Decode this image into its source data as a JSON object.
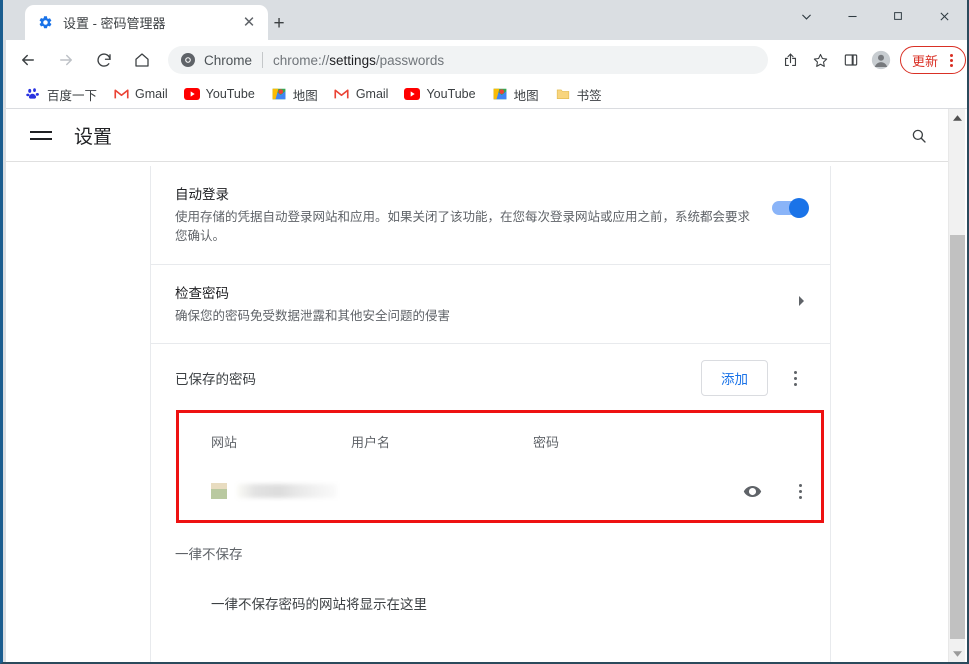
{
  "window": {
    "controls": [
      {
        "name": "tab-search-button",
        "glyph": "⌄"
      },
      {
        "name": "minimize-button",
        "glyph": "—"
      },
      {
        "name": "maximize-button",
        "glyph": "□"
      },
      {
        "name": "close-button",
        "glyph": "✕"
      }
    ]
  },
  "tab": {
    "title": "设置 - 密码管理器",
    "favicon": "gear-icon",
    "close_label": "✕",
    "newtab_label": "+"
  },
  "toolbar": {
    "back_label": "←",
    "forward_label": "→",
    "reload_label": "⟳",
    "home_label": "⌂",
    "omnibox": {
      "chrome_label": "Chrome",
      "url_prefix": "chrome://",
      "url_bold": "settings",
      "url_suffix": "/passwords",
      "full_url": "chrome://settings/passwords"
    },
    "share_label": "share-icon",
    "bookmark_label": "star-icon",
    "sidepanel_label": "side-panel-icon",
    "profile_label": "profile-avatar",
    "update_label": "更新"
  },
  "bookmarks": [
    {
      "label": "百度一下",
      "icon": "baidu-icon"
    },
    {
      "label": "Gmail",
      "icon": "gmail-icon"
    },
    {
      "label": "YouTube",
      "icon": "youtube-icon"
    },
    {
      "label": "地图",
      "icon": "maps-icon"
    },
    {
      "label": "Gmail",
      "icon": "gmail-icon"
    },
    {
      "label": "YouTube",
      "icon": "youtube-icon"
    },
    {
      "label": "地图",
      "icon": "maps-icon"
    },
    {
      "label": "书签",
      "icon": "folder-icon"
    }
  ],
  "settings": {
    "title": "设置",
    "menu_label": "hamburger-icon",
    "search_label": "search-icon"
  },
  "sections": {
    "autosignin": {
      "title": "自动登录",
      "subtitle": "使用存储的凭据自动登录网站和应用。如果关闭了该功能，在您每次登录网站或应用之前，系统都会要求您确认。",
      "toggle_on": true
    },
    "checkup": {
      "title": "检查密码",
      "subtitle": "确保您的密码免受数据泄露和其他安全问题的侵害",
      "chevron": "▸"
    },
    "saved": {
      "label": "已保存的密码",
      "add_label": "添加",
      "menu_label": "more-options",
      "columns": {
        "site": "网站",
        "username": "用户名",
        "password": "密码"
      },
      "rows": [
        {
          "site": "",
          "username": "",
          "password": "",
          "show_label": "eye-icon",
          "menu_label": "more-options",
          "redacted": true
        }
      ]
    },
    "never": {
      "label": "一律不保存",
      "empty_text": "一律不保存密码的网站将显示在这里"
    }
  },
  "colors": {
    "accent": "#1a73e8",
    "toggle_track": "#8ab4f8",
    "update_red": "#d93025",
    "highlight_red": "#ee1111",
    "text_primary": "#202124",
    "text_secondary": "#5f6368"
  },
  "scrollbar": {
    "up_arrow": "▲",
    "down_arrow": "▼"
  }
}
